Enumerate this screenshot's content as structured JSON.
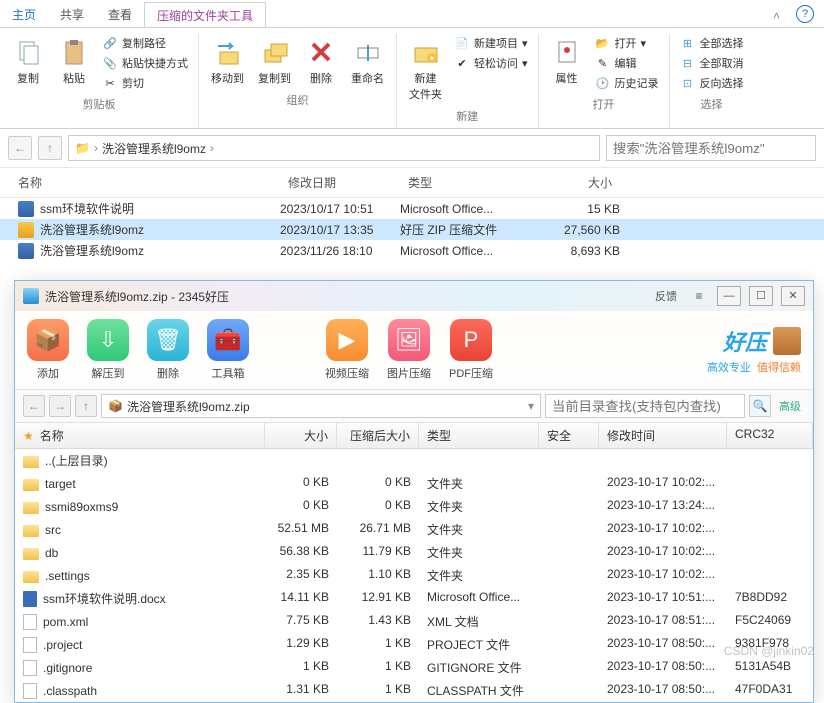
{
  "tabs": {
    "home": "主页",
    "share": "共享",
    "view": "查看",
    "zip_tools": "压缩的文件夹工具"
  },
  "ribbon": {
    "clipboard": {
      "label": "剪贴板",
      "copy": "复制",
      "paste": "粘贴",
      "copy_path": "复制路径",
      "paste_shortcut": "粘贴快捷方式",
      "cut": "剪切"
    },
    "organize": {
      "label": "组织",
      "move_to": "移动到",
      "copy_to": "复制到",
      "delete": "删除",
      "rename": "重命名"
    },
    "new": {
      "label": "新建",
      "new_folder": "新建\n文件夹",
      "new_item": "新建项目",
      "easy_access": "轻松访问"
    },
    "open": {
      "label": "打开",
      "properties": "属性",
      "open": "打开",
      "edit": "编辑",
      "history": "历史记录"
    },
    "select": {
      "label": "选择",
      "select_all": "全部选择",
      "select_none": "全部取消",
      "invert": "反向选择"
    }
  },
  "addr": {
    "crumb1": "洗浴管理系统l9omz",
    "search_placeholder": "搜索\"洗浴管理系统l9omz\""
  },
  "list_head": {
    "name": "名称",
    "date": "修改日期",
    "type": "类型",
    "size": "大小"
  },
  "files": [
    {
      "name": "ssm环境软件说明",
      "date": "2023/10/17 10:51",
      "type": "Microsoft Office...",
      "size": "15 KB",
      "icon": "doc"
    },
    {
      "name": "洗浴管理系统l9omz",
      "date": "2023/10/17 13:35",
      "type": "好压 ZIP 压缩文件",
      "size": "27,560 KB",
      "icon": "zip",
      "selected": true
    },
    {
      "name": "洗浴管理系统l9omz",
      "date": "2023/11/26 18:10",
      "type": "Microsoft Office...",
      "size": "8,693 KB",
      "icon": "doc"
    }
  ],
  "zip": {
    "title": "洗浴管理系统l9omz.zip - 2345好压",
    "feedback": "反馈",
    "toolbar": {
      "add": "添加",
      "extract": "解压到",
      "delete": "删除",
      "tools": "工具箱",
      "video": "视频压缩",
      "image": "图片压缩",
      "pdf": "PDF压缩"
    },
    "brand": {
      "logo": "好压",
      "slogan_a": "高效专业",
      "slogan_b": "值得信赖"
    },
    "crumb": "洗浴管理系统l9omz.zip",
    "search_placeholder": "当前目录查找(支持包内查找)",
    "adv": "高级",
    "head": {
      "name": "名称",
      "size": "大小",
      "comp": "压缩后大小",
      "type": "类型",
      "sec": "安全",
      "date": "修改时间",
      "crc": "CRC32"
    },
    "rows": [
      {
        "name": "..(上层目录)",
        "size": "",
        "comp": "",
        "type": "",
        "sec": "",
        "date": "",
        "crc": "",
        "icon": "folder"
      },
      {
        "name": "target",
        "size": "0 KB",
        "comp": "0 KB",
        "type": "文件夹",
        "sec": "",
        "date": "2023-10-17 10:02:...",
        "crc": "",
        "icon": "folder"
      },
      {
        "name": "ssmi89oxms9",
        "size": "0 KB",
        "comp": "0 KB",
        "type": "文件夹",
        "sec": "",
        "date": "2023-10-17 13:24:...",
        "crc": "",
        "icon": "folder"
      },
      {
        "name": "src",
        "size": "52.51 MB",
        "comp": "26.71 MB",
        "type": "文件夹",
        "sec": "",
        "date": "2023-10-17 10:02:...",
        "crc": "",
        "icon": "folder"
      },
      {
        "name": "db",
        "size": "56.38 KB",
        "comp": "11.79 KB",
        "type": "文件夹",
        "sec": "",
        "date": "2023-10-17 10:02:...",
        "crc": "",
        "icon": "folder"
      },
      {
        "name": ".settings",
        "size": "2.35 KB",
        "comp": "1.10 KB",
        "type": "文件夹",
        "sec": "",
        "date": "2023-10-17 10:02:...",
        "crc": "",
        "icon": "folder"
      },
      {
        "name": "ssm环境软件说明.docx",
        "size": "14.11 KB",
        "comp": "12.91 KB",
        "type": "Microsoft Office...",
        "sec": "",
        "date": "2023-10-17 10:51:...",
        "crc": "7B8DD92",
        "icon": "word"
      },
      {
        "name": "pom.xml",
        "size": "7.75 KB",
        "comp": "1.43 KB",
        "type": "XML 文档",
        "sec": "",
        "date": "2023-10-17 08:51:...",
        "crc": "F5C24069",
        "icon": "file"
      },
      {
        "name": ".project",
        "size": "1.29 KB",
        "comp": "1 KB",
        "type": "PROJECT 文件",
        "sec": "",
        "date": "2023-10-17 08:50:...",
        "crc": "9381F978",
        "icon": "file"
      },
      {
        "name": ".gitignore",
        "size": "1 KB",
        "comp": "1 KB",
        "type": "GITIGNORE 文件",
        "sec": "",
        "date": "2023-10-17 08:50:...",
        "crc": "5131A54B",
        "icon": "file"
      },
      {
        "name": ".classpath",
        "size": "1.31 KB",
        "comp": "1 KB",
        "type": "CLASSPATH 文件",
        "sec": "",
        "date": "2023-10-17 08:50:...",
        "crc": "47F0DA31",
        "icon": "file"
      }
    ]
  },
  "watermark": "CSDN @jinkin02"
}
